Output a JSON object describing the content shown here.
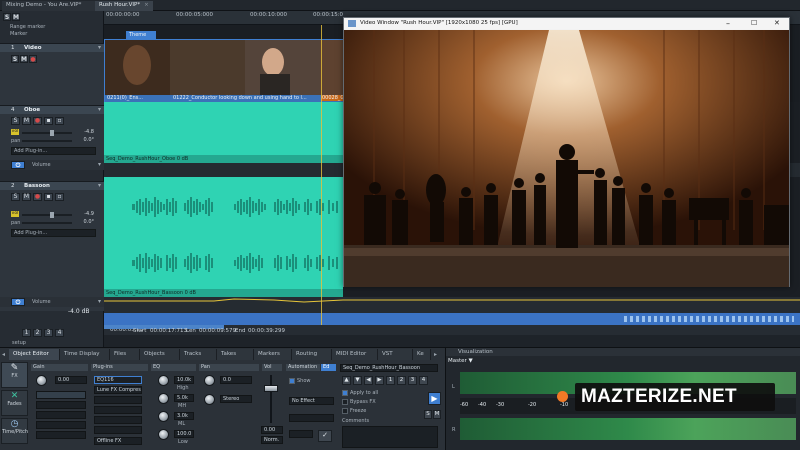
{
  "tabs": [
    {
      "label": "Mixing Demo - You Are.VIP*",
      "close": "×"
    },
    {
      "label": "Rush Hour.VIP*",
      "close": "×"
    }
  ],
  "global": {
    "solo": "S",
    "mute": "M",
    "range_marker": "Range marker",
    "marker": "Marker"
  },
  "ruler": {
    "labels": [
      "00:00:00:00",
      "00:00:05:000",
      "00:00:10:000",
      "00:00:15:0"
    ]
  },
  "tracks": [
    {
      "num": "1",
      "name": "Video",
      "theme_label": "Theme",
      "clips": [
        "0211(0)_Ens...",
        "01222_Conductor looking down and using hand to l...",
        "00028_G..."
      ]
    },
    {
      "num": "4",
      "name": "Oboe",
      "vol_label": "vol",
      "vol_value": "-4.8",
      "pan_label": "pan",
      "pan_value": "0.0°",
      "plugin_placeholder": "Add Plug-in...",
      "clip_name": "Seq_Demo_RushHour_Oboe  0 dB",
      "automation_label": "Volume"
    },
    {
      "num": "2",
      "name": "Bassoon",
      "vol_label": "vol",
      "vol_value": "-4.9",
      "pan_label": "pan",
      "pan_value": "0.0°",
      "plugin_placeholder": "Add Plug-in...",
      "clip_name": "Seq_Demo_RushHour_Bassoon  0 dB",
      "automation_label": "Volume",
      "automation_value": "-4.0 dB"
    }
  ],
  "transport": {
    "position": "00:00:05:25",
    "start_label": "Start",
    "start": "00:00:17:713",
    "len_label": "Len",
    "len": "00:00:09:579",
    "end_label": "End",
    "end": "00:00:39:299",
    "setup_label": "setup"
  },
  "video_window": {
    "title": "Video Window \"Rush Hour.VIP\"  [1920x1080 25 fps] [GPU]",
    "minimize": "–",
    "maximize": "☐",
    "close": "✕"
  },
  "bottom_tabs": [
    "Object Editor",
    "Time Display",
    "Files",
    "Objects",
    "Tracks",
    "Takes",
    "Markers",
    "Routing",
    "MIDI Editor",
    "VST",
    "Ke"
  ],
  "object_editor": {
    "tools": [
      "FX",
      "Fades",
      "Time/Pitch"
    ],
    "gain_label": "Gain",
    "gain_value": "0.00",
    "plugins_label": "Plug-ins",
    "eq_label": "EQ",
    "pan_label": "Pan",
    "vol_label": "Vol",
    "plugin_1": "EQ116",
    "plugin_2": "Lune FX Compres...",
    "eq_values": [
      "10.0k",
      "5.0k",
      "3.0k",
      "100.0"
    ],
    "eq_labels": [
      "High",
      "MH",
      "ML",
      "Low"
    ],
    "pan_value": "0.0",
    "pan_mode": "Stereo",
    "vol_value": "0.00",
    "vol_mode": "Norm.",
    "offline_fx": "Offline FX",
    "automation_label": "Automation",
    "ed_label": "Ed",
    "show_label": "Show",
    "no_effect": "No Effect",
    "pha": "Pha",
    "object_name": "Seq_Demo_RushHour_Bassoon",
    "apply_all": "Apply to all",
    "bypass_fx": "Bypass FX",
    "freeze": "Freeze",
    "comments": "Comments",
    "pages": [
      "1",
      "2",
      "3",
      "4"
    ],
    "small_buttons": [
      "S",
      "M"
    ],
    "track_pages": [
      "1",
      "2",
      "3",
      "4"
    ]
  },
  "visualization": {
    "header": "Visualization",
    "master": "Master ▼",
    "channel_l": "L",
    "channel_r": "R",
    "scale": [
      "-60",
      "-40",
      "-30",
      "-20",
      "-10"
    ]
  },
  "watermark": "MAZTERIZE.NET",
  "colors": {
    "clip": "#2fd3b3",
    "accent": "#3f7fd1",
    "playhead": "#e7c23b"
  }
}
